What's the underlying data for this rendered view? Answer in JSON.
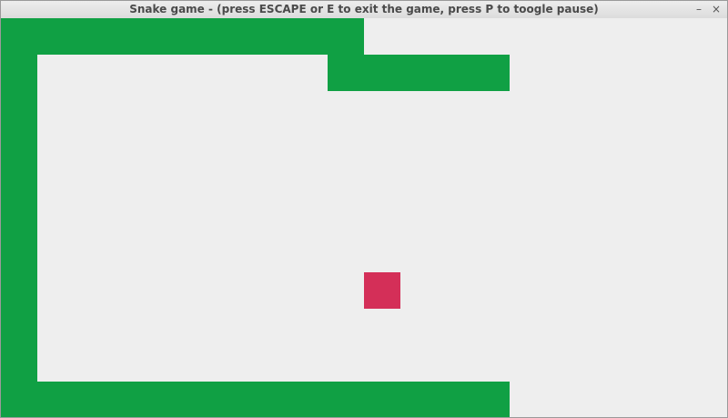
{
  "window": {
    "title": "Snake game - (press ESCAPE or E to exit the game, press P to toogle pause)",
    "minimize_glyph": "–",
    "close_glyph": "×"
  },
  "game": {
    "grid_cell_units": "20 board cells wide",
    "snake_color": "#10a044",
    "food_color": "#d42f58",
    "background_color": "#eeeeee",
    "paused": false
  }
}
